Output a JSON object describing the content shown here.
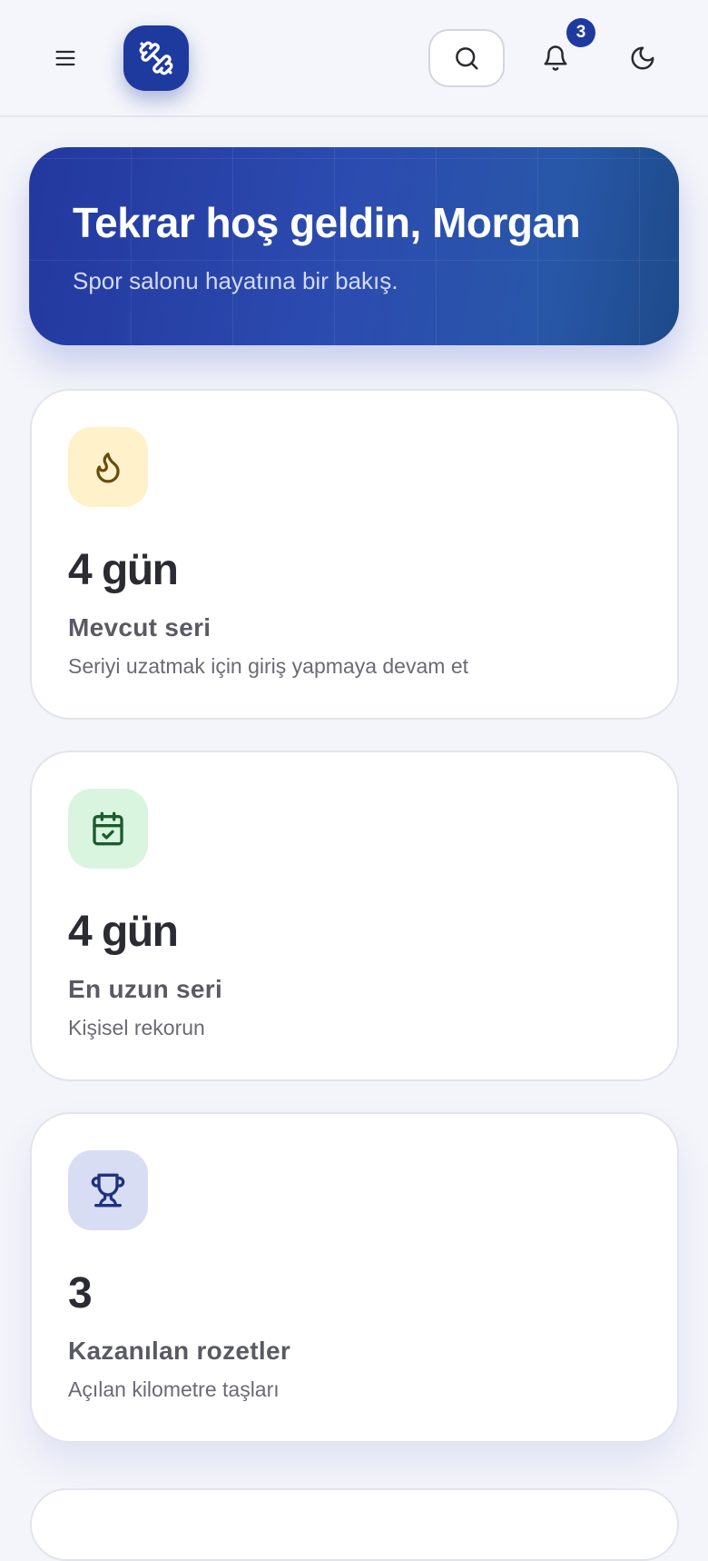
{
  "header": {
    "menu_icon": "menu-icon",
    "logo_icon": "dumbbell-icon",
    "search_icon": "search-icon",
    "notifications_icon": "bell-icon",
    "notification_count": "3",
    "theme_icon": "moon-icon",
    "brand_color": "#1f3a9e"
  },
  "hero": {
    "title": "Tekrar hoş geldin, Morgan",
    "subtitle": "Spor salonu hayatına bir bakış."
  },
  "stats": [
    {
      "icon": "flame-icon",
      "icon_bg": "#fff1c9",
      "icon_color": "#6b4a0e",
      "value": "4 gün",
      "label": "Mevcut seri",
      "description": "Seriyi uzatmak için giriş yapmaya devam et"
    },
    {
      "icon": "calendar-check-icon",
      "icon_bg": "#d9f5e0",
      "icon_color": "#1c5b2e",
      "value": "4 gün",
      "label": "En uzun seri",
      "description": "Kişisel rekorun"
    },
    {
      "icon": "trophy-icon",
      "icon_bg": "#d8ddf4",
      "icon_color": "#1f3280",
      "value": "3",
      "label": "Kazanılan rozetler",
      "description": "Açılan kilometre taşları"
    }
  ]
}
